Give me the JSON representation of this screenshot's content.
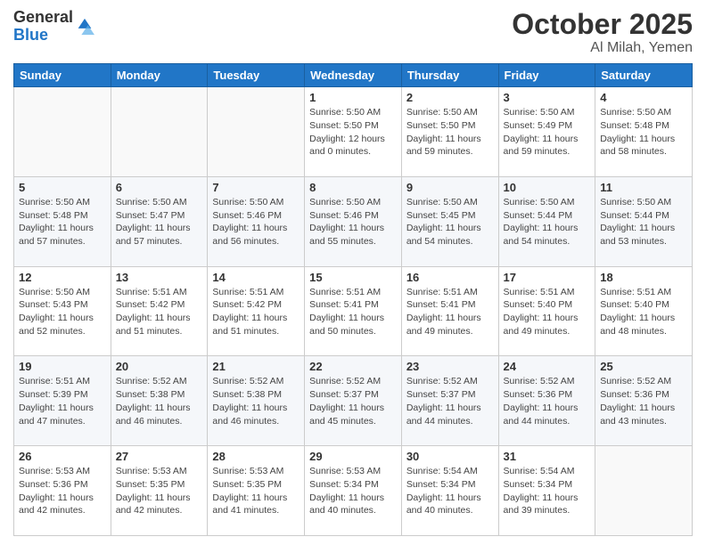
{
  "logo": {
    "general": "General",
    "blue": "Blue"
  },
  "header": {
    "month": "October 2025",
    "location": "Al Milah, Yemen"
  },
  "weekdays": [
    "Sunday",
    "Monday",
    "Tuesday",
    "Wednesday",
    "Thursday",
    "Friday",
    "Saturday"
  ],
  "weeks": [
    [
      {
        "day": "",
        "info": ""
      },
      {
        "day": "",
        "info": ""
      },
      {
        "day": "",
        "info": ""
      },
      {
        "day": "1",
        "info": "Sunrise: 5:50 AM\nSunset: 5:50 PM\nDaylight: 12 hours\nand 0 minutes."
      },
      {
        "day": "2",
        "info": "Sunrise: 5:50 AM\nSunset: 5:50 PM\nDaylight: 11 hours\nand 59 minutes."
      },
      {
        "day": "3",
        "info": "Sunrise: 5:50 AM\nSunset: 5:49 PM\nDaylight: 11 hours\nand 59 minutes."
      },
      {
        "day": "4",
        "info": "Sunrise: 5:50 AM\nSunset: 5:48 PM\nDaylight: 11 hours\nand 58 minutes."
      }
    ],
    [
      {
        "day": "5",
        "info": "Sunrise: 5:50 AM\nSunset: 5:48 PM\nDaylight: 11 hours\nand 57 minutes."
      },
      {
        "day": "6",
        "info": "Sunrise: 5:50 AM\nSunset: 5:47 PM\nDaylight: 11 hours\nand 57 minutes."
      },
      {
        "day": "7",
        "info": "Sunrise: 5:50 AM\nSunset: 5:46 PM\nDaylight: 11 hours\nand 56 minutes."
      },
      {
        "day": "8",
        "info": "Sunrise: 5:50 AM\nSunset: 5:46 PM\nDaylight: 11 hours\nand 55 minutes."
      },
      {
        "day": "9",
        "info": "Sunrise: 5:50 AM\nSunset: 5:45 PM\nDaylight: 11 hours\nand 54 minutes."
      },
      {
        "day": "10",
        "info": "Sunrise: 5:50 AM\nSunset: 5:44 PM\nDaylight: 11 hours\nand 54 minutes."
      },
      {
        "day": "11",
        "info": "Sunrise: 5:50 AM\nSunset: 5:44 PM\nDaylight: 11 hours\nand 53 minutes."
      }
    ],
    [
      {
        "day": "12",
        "info": "Sunrise: 5:50 AM\nSunset: 5:43 PM\nDaylight: 11 hours\nand 52 minutes."
      },
      {
        "day": "13",
        "info": "Sunrise: 5:51 AM\nSunset: 5:42 PM\nDaylight: 11 hours\nand 51 minutes."
      },
      {
        "day": "14",
        "info": "Sunrise: 5:51 AM\nSunset: 5:42 PM\nDaylight: 11 hours\nand 51 minutes."
      },
      {
        "day": "15",
        "info": "Sunrise: 5:51 AM\nSunset: 5:41 PM\nDaylight: 11 hours\nand 50 minutes."
      },
      {
        "day": "16",
        "info": "Sunrise: 5:51 AM\nSunset: 5:41 PM\nDaylight: 11 hours\nand 49 minutes."
      },
      {
        "day": "17",
        "info": "Sunrise: 5:51 AM\nSunset: 5:40 PM\nDaylight: 11 hours\nand 49 minutes."
      },
      {
        "day": "18",
        "info": "Sunrise: 5:51 AM\nSunset: 5:40 PM\nDaylight: 11 hours\nand 48 minutes."
      }
    ],
    [
      {
        "day": "19",
        "info": "Sunrise: 5:51 AM\nSunset: 5:39 PM\nDaylight: 11 hours\nand 47 minutes."
      },
      {
        "day": "20",
        "info": "Sunrise: 5:52 AM\nSunset: 5:38 PM\nDaylight: 11 hours\nand 46 minutes."
      },
      {
        "day": "21",
        "info": "Sunrise: 5:52 AM\nSunset: 5:38 PM\nDaylight: 11 hours\nand 46 minutes."
      },
      {
        "day": "22",
        "info": "Sunrise: 5:52 AM\nSunset: 5:37 PM\nDaylight: 11 hours\nand 45 minutes."
      },
      {
        "day": "23",
        "info": "Sunrise: 5:52 AM\nSunset: 5:37 PM\nDaylight: 11 hours\nand 44 minutes."
      },
      {
        "day": "24",
        "info": "Sunrise: 5:52 AM\nSunset: 5:36 PM\nDaylight: 11 hours\nand 44 minutes."
      },
      {
        "day": "25",
        "info": "Sunrise: 5:52 AM\nSunset: 5:36 PM\nDaylight: 11 hours\nand 43 minutes."
      }
    ],
    [
      {
        "day": "26",
        "info": "Sunrise: 5:53 AM\nSunset: 5:36 PM\nDaylight: 11 hours\nand 42 minutes."
      },
      {
        "day": "27",
        "info": "Sunrise: 5:53 AM\nSunset: 5:35 PM\nDaylight: 11 hours\nand 42 minutes."
      },
      {
        "day": "28",
        "info": "Sunrise: 5:53 AM\nSunset: 5:35 PM\nDaylight: 11 hours\nand 41 minutes."
      },
      {
        "day": "29",
        "info": "Sunrise: 5:53 AM\nSunset: 5:34 PM\nDaylight: 11 hours\nand 40 minutes."
      },
      {
        "day": "30",
        "info": "Sunrise: 5:54 AM\nSunset: 5:34 PM\nDaylight: 11 hours\nand 40 minutes."
      },
      {
        "day": "31",
        "info": "Sunrise: 5:54 AM\nSunset: 5:34 PM\nDaylight: 11 hours\nand 39 minutes."
      },
      {
        "day": "",
        "info": ""
      }
    ]
  ]
}
